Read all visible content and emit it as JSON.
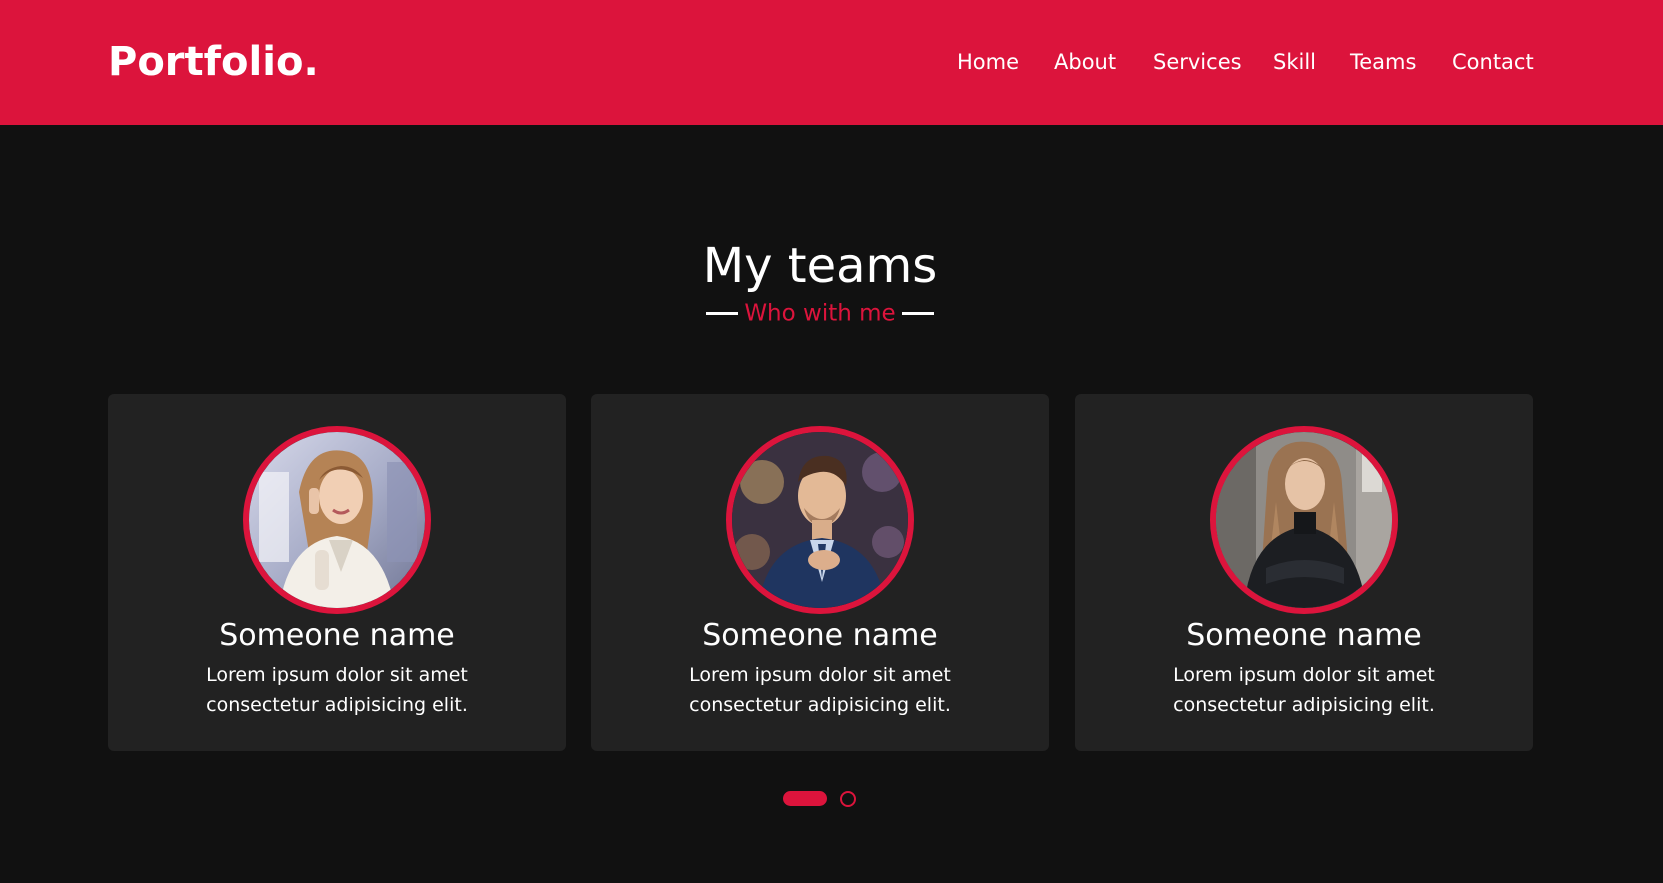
{
  "header": {
    "logo_text": "Portfolio",
    "logo_dot": ".",
    "nav": [
      {
        "label": "Home"
      },
      {
        "label": "About"
      },
      {
        "label": "Services"
      },
      {
        "label": "Skill"
      },
      {
        "label": "Teams"
      },
      {
        "label": "Contact"
      }
    ]
  },
  "teams": {
    "title": "My teams",
    "subtitle": "Who with me",
    "members": [
      {
        "name": "Someone name",
        "desc_line1": "Lorem ipsum dolor sit amet",
        "desc_line2": "consectetur adipisicing elit."
      },
      {
        "name": "Someone name",
        "desc_line1": "Lorem ipsum dolor sit amet",
        "desc_line2": "consectetur adipisicing elit."
      },
      {
        "name": "Someone name",
        "desc_line1": "Lorem ipsum dolor sit amet",
        "desc_line2": "consectetur adipisicing elit."
      }
    ]
  },
  "carousel": {
    "current_page": 1,
    "total_pages": 2
  },
  "colors": {
    "accent": "#dc143c",
    "background": "#111111",
    "card": "#222222",
    "text": "#ffffff"
  }
}
